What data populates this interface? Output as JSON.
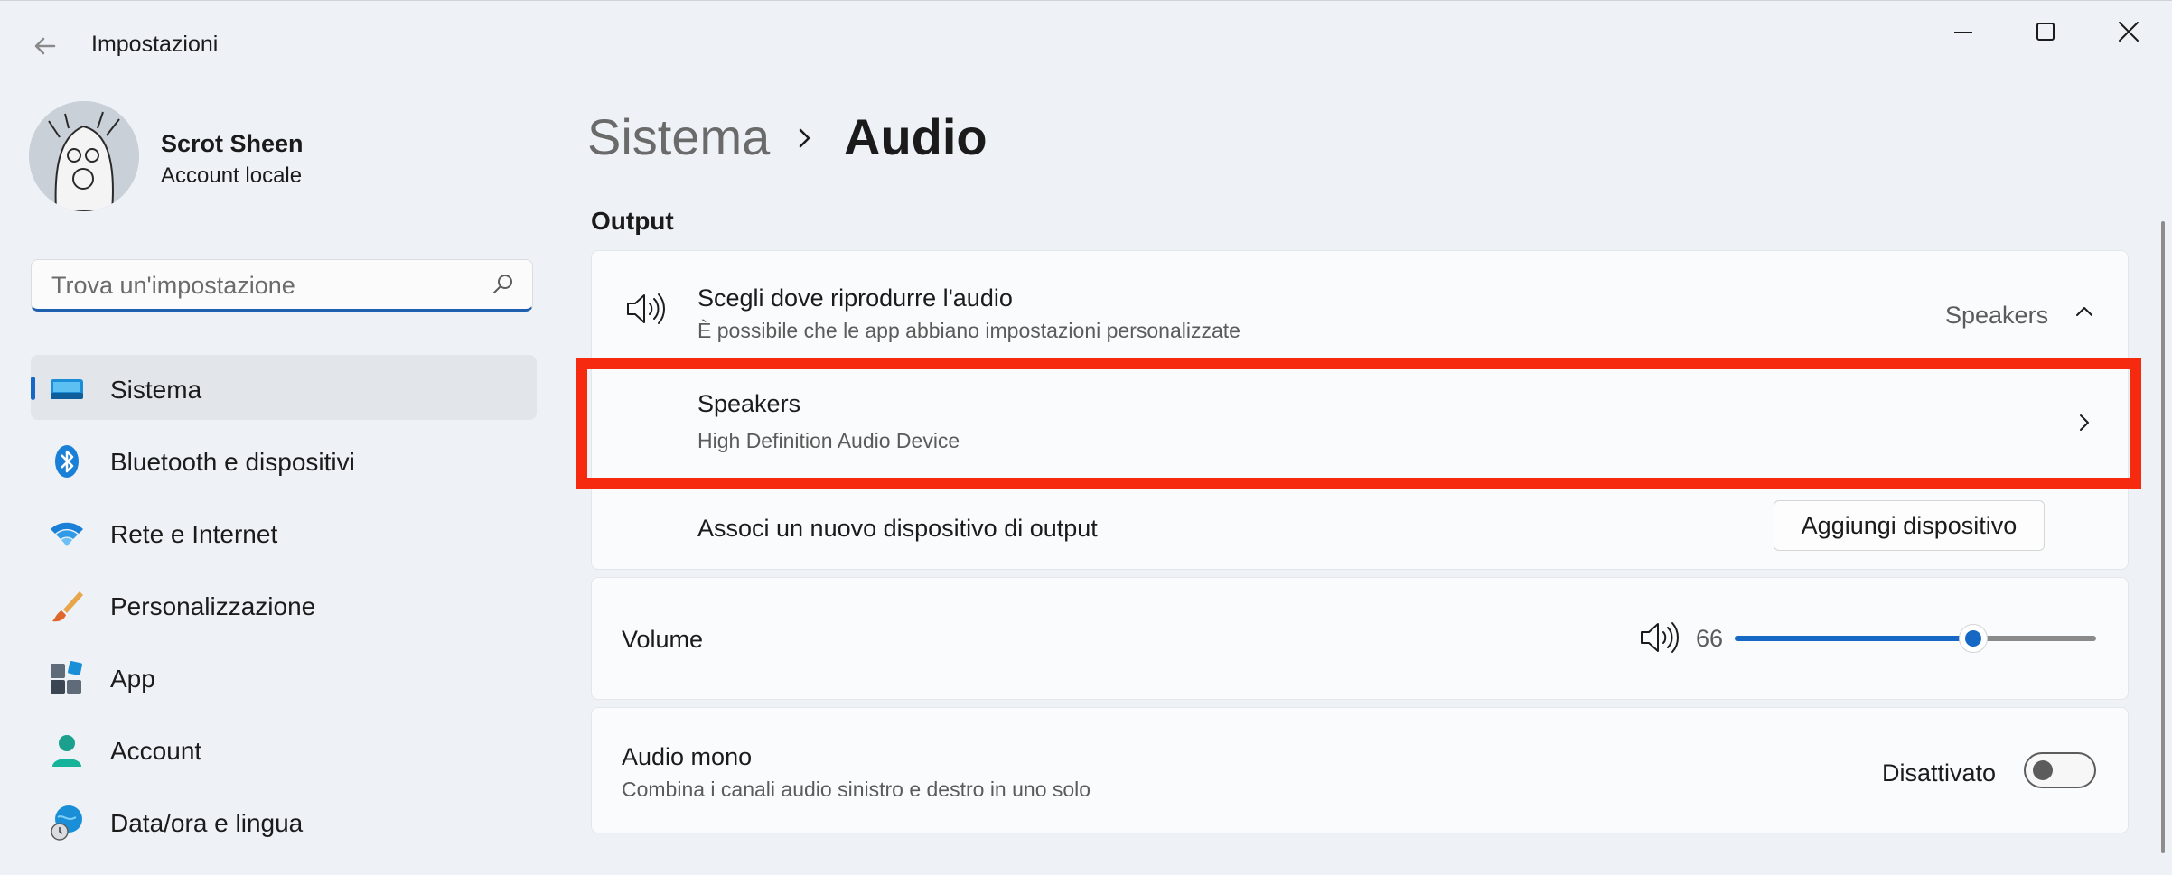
{
  "window": {
    "title": "Impostazioni"
  },
  "user": {
    "name": "Scrot Sheen",
    "account_type": "Account locale"
  },
  "search": {
    "placeholder": "Trova un'impostazione",
    "value": ""
  },
  "sidebar": {
    "items": [
      {
        "label": "Sistema",
        "icon": "system-icon",
        "selected": true
      },
      {
        "label": "Bluetooth e dispositivi",
        "icon": "bluetooth-icon",
        "selected": false
      },
      {
        "label": "Rete e Internet",
        "icon": "wifi-icon",
        "selected": false
      },
      {
        "label": "Personalizzazione",
        "icon": "brush-icon",
        "selected": false
      },
      {
        "label": "App",
        "icon": "apps-icon",
        "selected": false
      },
      {
        "label": "Account",
        "icon": "account-icon",
        "selected": false
      },
      {
        "label": "Data/ora e lingua",
        "icon": "clock-globe-icon",
        "selected": false
      }
    ]
  },
  "breadcrumb": {
    "parent": "Sistema",
    "current": "Audio"
  },
  "output": {
    "section_title": "Output",
    "choose_device": {
      "title": "Scegli dove riprodurre l'audio",
      "subtitle": "È possibile che le app abbiano impostazioni personalizzate",
      "value": "Speakers",
      "expanded": true
    },
    "device": {
      "name": "Speakers",
      "description": "High Definition Audio Device"
    },
    "pair": {
      "label": "Associ un nuovo dispositivo di output",
      "button_label": "Aggiungi dispositivo"
    }
  },
  "volume": {
    "label": "Volume",
    "value": 66,
    "max": 100
  },
  "mono": {
    "title": "Audio mono",
    "subtitle": "Combina i canali audio sinistro e destro in uno solo",
    "state_label": "Disattivato",
    "on": false
  },
  "colors": {
    "accent": "#1668c5",
    "highlight": "#f52a0f"
  }
}
